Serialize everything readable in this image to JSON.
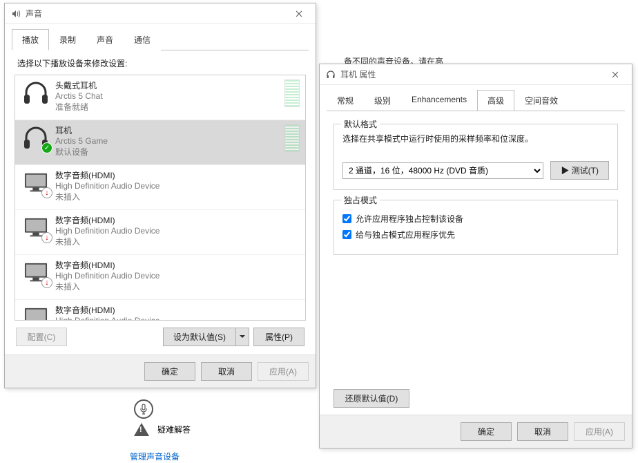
{
  "bg": {
    "text_fragment": "备不同的声音设备。请在高",
    "troubleshoot": "疑难解答",
    "manage_link": "管理声音设备"
  },
  "sound": {
    "title": "声音",
    "tabs": [
      "播放",
      "录制",
      "声音",
      "通信"
    ],
    "active_tab": 0,
    "instruction": "选择以下播放设备来修改设置:",
    "devices": [
      {
        "name": "头戴式耳机",
        "sub": "Arctis 5 Chat",
        "status": "准备就绪",
        "icon": "headphones",
        "badge": "none",
        "meter": true,
        "selected": false
      },
      {
        "name": "耳机",
        "sub": "Arctis 5 Game",
        "status": "默认设备",
        "icon": "headphones",
        "badge": "check",
        "meter": true,
        "selected": true
      },
      {
        "name": "数字音频(HDMI)",
        "sub": "High Definition Audio Device",
        "status": "未插入",
        "icon": "monitor",
        "badge": "down",
        "meter": false,
        "selected": false
      },
      {
        "name": "数字音频(HDMI)",
        "sub": "High Definition Audio Device",
        "status": "未插入",
        "icon": "monitor",
        "badge": "down",
        "meter": false,
        "selected": false
      },
      {
        "name": "数字音频(HDMI)",
        "sub": "High Definition Audio Device",
        "status": "未插入",
        "icon": "monitor",
        "badge": "down",
        "meter": false,
        "selected": false
      },
      {
        "name": "数字音频(HDMI)",
        "sub": "High Definition Audio Device",
        "status": "",
        "icon": "monitor",
        "badge": "none",
        "meter": false,
        "selected": false
      }
    ],
    "configure_btn": "配置(C)",
    "set_default_btn": "设为默认值(S)",
    "properties_btn": "属性(P)",
    "ok": "确定",
    "cancel": "取消",
    "apply": "应用(A)"
  },
  "props": {
    "title": "耳机 属性",
    "tabs": [
      "常规",
      "级别",
      "Enhancements",
      "高级",
      "空间音效"
    ],
    "active_tab": 3,
    "default_format_group": "默认格式",
    "default_format_desc": "选择在共享模式中运行时使用的采样频率和位深度。",
    "format_value": "2 通道，16 位，48000 Hz (DVD 音质)",
    "test_btn": "▶  测试(T)",
    "exclusive_group": "独占模式",
    "chk1": "允许应用程序独占控制该设备",
    "chk2": "给与独占模式应用程序优先",
    "restore_btn": "还原默认值(D)",
    "ok": "确定",
    "cancel": "取消",
    "apply": "应用(A)"
  }
}
